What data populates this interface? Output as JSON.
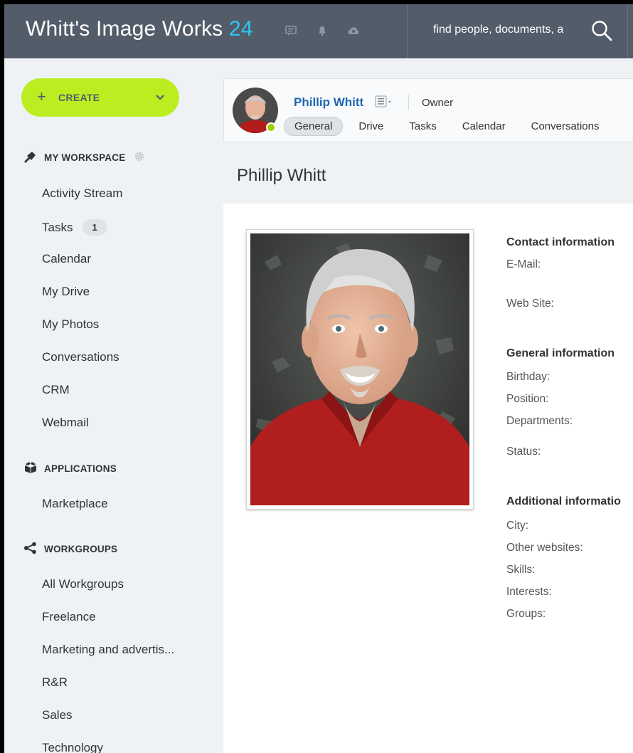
{
  "header": {
    "brand_name": "Whitt's Image Works",
    "brand_number": "24",
    "icons": [
      "chat-icon",
      "bell-icon",
      "cloud-icon"
    ],
    "search_placeholder": "find people, documents, a",
    "colors": {
      "bar": "#535c69",
      "accent": "#2fc6f6"
    }
  },
  "sidebar": {
    "create": {
      "label": "CREATE",
      "color": "#bbed21"
    },
    "sections": [
      {
        "title": "MY WORKSPACE",
        "icon": "pin-icon"
      },
      {
        "title": "APPLICATIONS",
        "icon": "box-icon"
      },
      {
        "title": "WORKGROUPS",
        "icon": "share-icon"
      }
    ],
    "workspace_items": [
      "Activity Stream",
      "Tasks",
      "Calendar",
      "My Drive",
      "My Photos",
      "Conversations",
      "CRM",
      "Webmail"
    ],
    "tasks_badge": "1",
    "application_items": [
      "Marketplace"
    ],
    "workgroup_items": [
      "All Workgroups",
      "Freelance",
      "Marketing and advertis...",
      "R&R",
      "Sales",
      "Technology"
    ]
  },
  "profile_card": {
    "name": "Phillip Whitt",
    "role": "Owner",
    "status": "online",
    "tabs": [
      "General",
      "Drive",
      "Tasks",
      "Calendar",
      "Conversations"
    ],
    "active_tab": "General"
  },
  "page": {
    "title": "Phillip Whitt"
  },
  "info": {
    "contact_heading": "Contact information",
    "contact_fields": [
      "E-Mail:",
      "Web Site:"
    ],
    "general_heading": "General information",
    "general_fields": [
      "Birthday:",
      "Position:",
      "Departments:",
      "Status:"
    ],
    "additional_heading": "Additional informatio",
    "additional_fields": [
      "City:",
      "Other websites:",
      "Skills:",
      "Interests:",
      "Groups:"
    ]
  }
}
